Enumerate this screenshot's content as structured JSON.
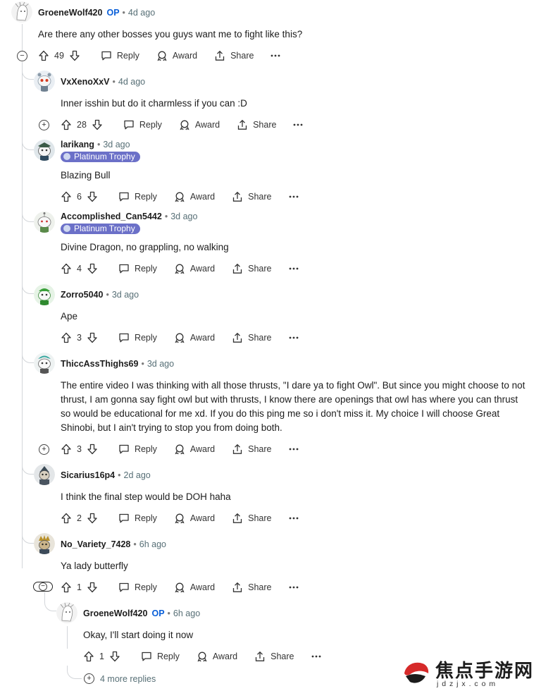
{
  "action_labels": {
    "reply": "Reply",
    "award": "Award",
    "share": "Share"
  },
  "comments": [
    {
      "author": "GroeneWolf420",
      "op_badge": "OP",
      "time": "4d ago",
      "text": "Are there any other bosses you guys want me to fight like this?",
      "votes": "49"
    },
    {
      "author": "VxXenoXxV",
      "time": "4d ago",
      "text": "Inner isshin but do it charmless if you can :D",
      "votes": "28"
    },
    {
      "author": "larikang",
      "time": "3d ago",
      "flair": "Platinum Trophy",
      "text": "Blazing Bull",
      "votes": "6"
    },
    {
      "author": "Accomplished_Can5442",
      "time": "3d ago",
      "flair": "Platinum Trophy",
      "text": "Divine Dragon, no grappling, no walking",
      "votes": "4"
    },
    {
      "author": "Zorro5040",
      "time": "3d ago",
      "text": "Ape",
      "votes": "3"
    },
    {
      "author": "ThiccAssThighs69",
      "time": "3d ago",
      "text": "The entire video I was thinking with all those thrusts, \"I dare ya to fight Owl\". But since you might choose to not thrust, I am gonna say fight owl but with thrusts, I know there are openings that owl has where you can thrust so would be educational for me xd. If you do this ping me so i don't miss it. My choice I will choose Great Shinobi, but I ain't trying to stop you from doing both.",
      "votes": "3"
    },
    {
      "author": "Sicarius16p4",
      "time": "2d ago",
      "text": "I think the final step would be DOH haha",
      "votes": "2"
    },
    {
      "author": "No_Variety_7428",
      "time": "6h ago",
      "text": "Ya lady butterfly",
      "votes": "1"
    },
    {
      "author": "GroeneWolf420",
      "op_badge": "OP",
      "time": "6h ago",
      "text": "Okay, I'll start doing it now",
      "votes": "1"
    }
  ],
  "more_replies": "4 more replies",
  "watermark": {
    "text": "焦点手游网",
    "subtext": "j d z j x . c o m"
  }
}
